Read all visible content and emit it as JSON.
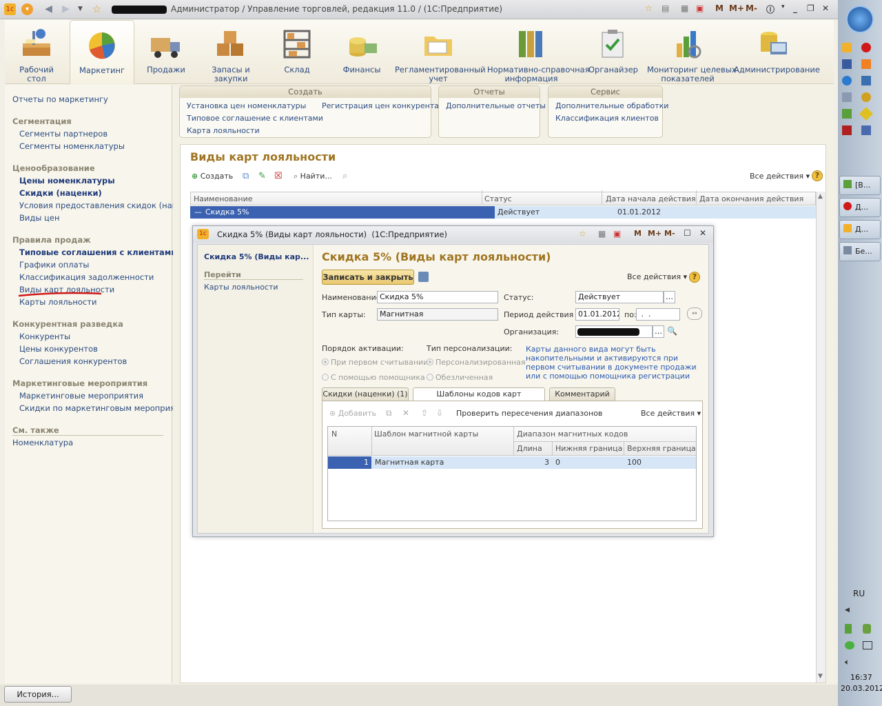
{
  "window": {
    "title_suffix": "Администратор / Управление торговлей, редакция 11.0 / (1С:Предприятие)",
    "tb_m": "M",
    "tb_mplus": "M+",
    "tb_mminus": "M-"
  },
  "ribbon": {
    "items": [
      {
        "label": "Рабочий\nстол",
        "icon": "desk-icon"
      },
      {
        "label": "Маркетинг",
        "icon": "pie-chart-icon"
      },
      {
        "label": "Продажи",
        "icon": "truck-icon"
      },
      {
        "label": "Запасы и\nзакупки",
        "icon": "boxes-icon"
      },
      {
        "label": "Склад",
        "icon": "warehouse-icon"
      },
      {
        "label": "Финансы",
        "icon": "coins-icon"
      },
      {
        "label": "Регламентированный\nучет",
        "icon": "folder-icon"
      },
      {
        "label": "Нормативно-справочная\nинформация",
        "icon": "binders-icon"
      },
      {
        "label": "Органайзер",
        "icon": "clipboard-icon"
      },
      {
        "label": "Мониторинг целевых\nпоказателей",
        "icon": "bars-icon"
      },
      {
        "label": "Администрирование",
        "icon": "server-icon"
      }
    ]
  },
  "left": {
    "top": "Отчеты по маркетингу",
    "s1": "Сегментация",
    "s1a": "Сегменты партнеров",
    "s1b": "Сегменты номенклатуры",
    "s2": "Ценообразование",
    "s2a": "Цены номенклатуры",
    "s2b": "Скидки (наценки)",
    "s2c": "Условия предоставления скидок (наце...",
    "s2d": "Виды цен",
    "s3": "Правила продаж",
    "s3a": "Типовые соглашения с клиентами",
    "s3b": "Графики оплаты",
    "s3c": "Классификация задолженности",
    "s3d": "Виды карт лояльности",
    "s3e": "Карты лояльности",
    "s4": "Конкурентная разведка",
    "s4a": "Конкуренты",
    "s4b": "Цены конкурентов",
    "s4c": "Соглашения конкурентов",
    "s5": "Маркетинговые мероприятия",
    "s5a": "Маркетинговые мероприятия",
    "s5b": "Скидки по маркетинговым мероприят...",
    "s6": "См. также",
    "s6a": "Номенклатура"
  },
  "groups": {
    "create": {
      "title": "Создать",
      "i1": "Установка цен номенклатуры",
      "i2": "Типовое соглашение с клиентами",
      "i3": "Карта лояльности",
      "i4": "Регистрация цен конкурента"
    },
    "reports": {
      "title": "Отчеты",
      "i1": "Дополнительные отчеты"
    },
    "service": {
      "title": "Сервис",
      "i1": "Дополнительные обработки",
      "i2": "Классификация клиентов"
    }
  },
  "list": {
    "title": "Виды карт лояльности",
    "btn_create": "Создать",
    "btn_find": "Найти...",
    "all_actions": "Все действия",
    "cols": {
      "name": "Наименование",
      "status": "Статус",
      "start": "Дата начала действия",
      "end": "Дата окончания действия"
    },
    "row": {
      "name": "Скидка 5%",
      "status": "Действует",
      "start": "01.01.2012",
      "end": ""
    }
  },
  "dialog": {
    "title": "Скидка 5% (Виды карт лояльности)  (1С:Предприятие)",
    "nav_title": "Скидка 5% (Виды кар...",
    "nav_goto": "Перейти",
    "nav_link": "Карты лояльности",
    "heading": "Скидка 5% (Виды карт лояльности)",
    "save_close": "Записать и закрыть",
    "all_actions": "Все действия",
    "lbl_name": "Наименование:",
    "val_name": "Скидка 5%",
    "lbl_type": "Тип карты:",
    "val_type": "Магнитная",
    "lbl_status": "Статус:",
    "val_status": "Действует",
    "lbl_period": "Период действия с:",
    "val_from": "01.01.2012",
    "lbl_to": "по:",
    "val_to": " .  .",
    "lbl_org": "Организация:",
    "lbl_activation": "Порядок активации:",
    "act1": "При первом считывании",
    "act2": "С помощью помощника",
    "lbl_person": "Тип персонализации:",
    "per1": "Персонализированная",
    "per2": "Обезличенная",
    "hint": "Карты данного вида могут быть накопительными и активируются при первом считывании в документе продажи или с помощью помощника регистрации",
    "tabs": [
      "Скидки (наценки) (1)",
      "Шаблоны кодов карт лояльности",
      "Комментарий"
    ],
    "tab_add": "Добавить",
    "tab_check": "Проверить пересечения диапазонов",
    "tab_all_actions": "Все действия",
    "grid": {
      "n": "N",
      "tpl": "Шаблон магнитной карты",
      "range": "Диапазон магнитных кодов",
      "len": "Длина",
      "low": "Нижняя граница",
      "high": "Верхняя граница",
      "row": {
        "n": "1",
        "tpl": "Магнитная карта",
        "len": "3",
        "low": "0",
        "high": "100"
      }
    }
  },
  "status": {
    "history": "История..."
  },
  "tray": {
    "btn1": "[В...",
    "btn2": "Д...",
    "btn3": "Д...",
    "btn4": "Бе...",
    "lang": "RU",
    "time": "16:37",
    "date": "20.03.2012"
  },
  "colors": {
    "accent_gold": "#a07522",
    "link_blue": "#2c4b80",
    "selection": "#d7e6f7"
  }
}
